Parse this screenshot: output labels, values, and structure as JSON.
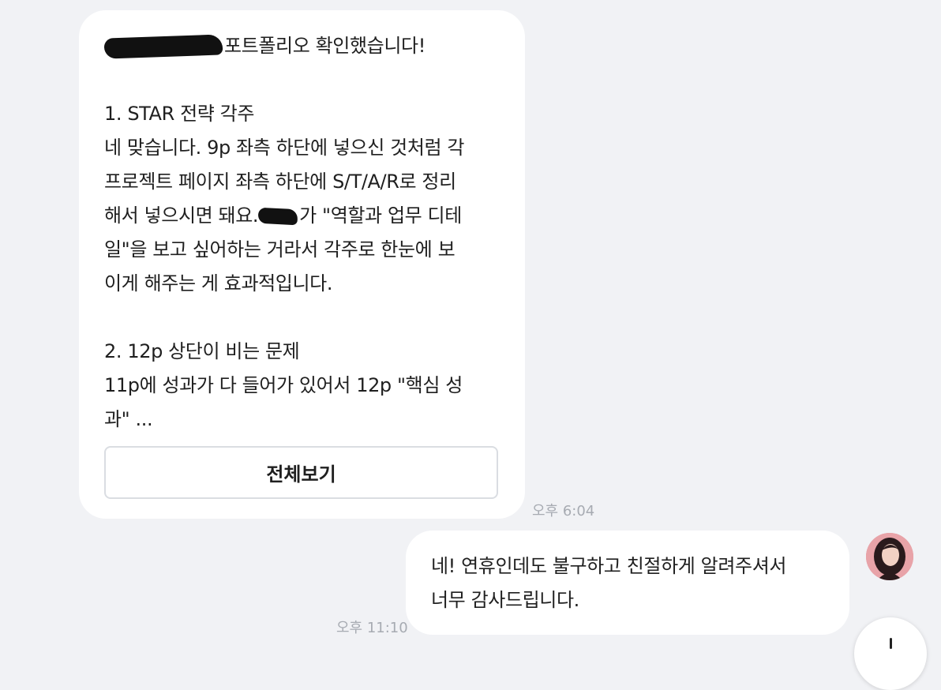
{
  "chat": {
    "incoming": {
      "greeting_suffix": "포트폴리오 확인했습니다!",
      "section1_title": "1. STAR 전략 각주",
      "section1_line1": "네 맞습니다. 9p 좌측 하단에 넣으신 것처럼 각",
      "section1_line2": "프로젝트 페이지 좌측 하단에 S/T/A/R로 정리",
      "section1_line3_pre": "해서 넣으시면 돼요.",
      "section1_line3_post": "가 \"역할과 업무 디테",
      "section1_line4": "일\"을 보고 싶어하는 거라서 각주로 한눈에 보",
      "section1_line5": "이게 해주는 게 효과적입니다.",
      "section2_title": "2. 12p 상단이 비는 문제",
      "section2_line1": "11p에 성과가 다 들어가 있어서 12p \"핵심 성",
      "section2_line2": "과\" ...",
      "view_all_label": "전체보기",
      "time": "오후 6:04"
    },
    "outgoing": {
      "line1": "네! 연휴인데도 불구하고 친절하게 알려주셔서",
      "line2": "너무 감사드립니다.",
      "time": "오후 11:10"
    }
  },
  "colors": {
    "background": "#f1f2f5",
    "bubble": "#ffffff",
    "text": "#1f1f1f",
    "timestamp": "#a7abb2",
    "button_border": "#dadde2"
  },
  "icons": {
    "avatar": "profile-avatar",
    "fab": "scroll-down-icon"
  }
}
